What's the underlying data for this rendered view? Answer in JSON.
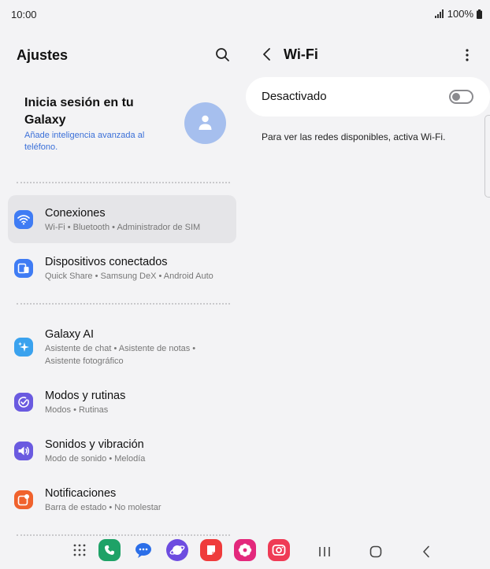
{
  "status_bar": {
    "time": "10:00",
    "battery": "100%"
  },
  "settings": {
    "title": "Ajustes",
    "account": {
      "title": "Inicia sesión en tu Galaxy",
      "subtitle": "Añade inteligencia avanzada al teléfono."
    },
    "items": [
      {
        "label": "Conexiones",
        "subtitle": "Wi-Fi  •  Bluetooth  •  Administrador de SIM",
        "icon": "wifi-icon",
        "color": "#3f7cf4"
      },
      {
        "label": "Dispositivos conectados",
        "subtitle": "Quick Share  •  Samsung DeX  •  Android Auto",
        "icon": "devices-icon",
        "color": "#3f7cf4"
      },
      {
        "label": "Galaxy AI",
        "subtitle": "Asistente de chat  •  Asistente de notas  •  Asistente fotográfico",
        "icon": "sparkle-icon",
        "color": "#3aa2ee"
      },
      {
        "label": "Modos y rutinas",
        "subtitle": "Modos  •  Rutinas",
        "icon": "check-circle-icon",
        "color": "#6a5ae0"
      },
      {
        "label": "Sonidos y vibración",
        "subtitle": "Modo de sonido  •  Melodía",
        "icon": "speaker-icon",
        "color": "#6a5ae0"
      },
      {
        "label": "Notificaciones",
        "subtitle": "Barra de estado  •  No molestar",
        "icon": "notification-icon",
        "color": "#f0622d"
      }
    ]
  },
  "wifi": {
    "title": "Wi-Fi",
    "toggle_label": "Desactivado",
    "enabled": false,
    "hint": "Para ver las redes disponibles, activa Wi-Fi."
  },
  "colors": {
    "background": "#f3f3f5",
    "accent_link": "#3a6fd8",
    "selected_row": "#e5e5e8"
  },
  "dock": [
    {
      "app": "phone",
      "icon": "phone-icon",
      "color": "#1ea267"
    },
    {
      "app": "messages",
      "icon": "chat-bubble-icon",
      "color": "#2b6ee8"
    },
    {
      "app": "internet",
      "icon": "planet-icon",
      "color": "#6d4ce0"
    },
    {
      "app": "notes",
      "icon": "note-icon",
      "color": "#ef3b3b"
    },
    {
      "app": "gallery",
      "icon": "flower-icon",
      "color": "#e3287c"
    },
    {
      "app": "camera",
      "icon": "camera-icon",
      "color": "#ef3b55"
    }
  ]
}
